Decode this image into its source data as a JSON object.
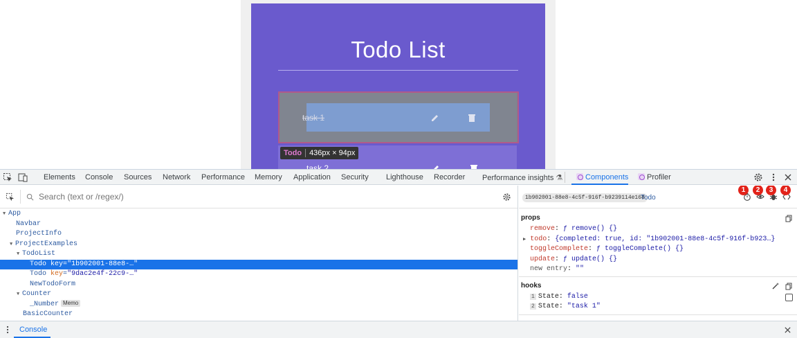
{
  "app": {
    "title": "Todo List",
    "todos": [
      {
        "text": "task 1",
        "completed": true
      },
      {
        "text": "task 2",
        "completed": false
      }
    ]
  },
  "inspect_tooltip": {
    "component": "Todo",
    "size": "436px × 94px"
  },
  "devtools": {
    "tabs": [
      "Elements",
      "Console",
      "Sources",
      "Network",
      "Performance",
      "Memory",
      "Application",
      "Security",
      "Lighthouse",
      "Recorder",
      "Performance insights"
    ],
    "react_tabs": [
      "Components",
      "Profiler"
    ],
    "active_tab": "Components",
    "search": {
      "placeholder": "Search (text or /regex/)"
    },
    "tree": [
      {
        "name": "App",
        "depth": 0,
        "expanded": true
      },
      {
        "name": "Navbar",
        "depth": 1
      },
      {
        "name": "ProjectInfo",
        "depth": 1
      },
      {
        "name": "ProjectExamples",
        "depth": 1,
        "expanded": true
      },
      {
        "name": "TodoList",
        "depth": 2,
        "expanded": true
      },
      {
        "name": "Todo",
        "depth": 3,
        "key": "\"1b902001-88e8-…\"",
        "selected": true
      },
      {
        "name": "Todo",
        "depth": 3,
        "key": "\"9dac2e4f-22c9-…\""
      },
      {
        "name": "NewTodoForm",
        "depth": 3
      },
      {
        "name": "Counter",
        "depth": 2,
        "expanded": true
      },
      {
        "name": "_Number",
        "depth": 3,
        "badge": "Memo"
      },
      {
        "name": "BasicCounter",
        "depth": 3
      }
    ],
    "selected": {
      "key": "1b902001-88e8-4c5f-916f-b9239114e168",
      "component": "Todo",
      "badges": [
        "1",
        "2",
        "3",
        "4"
      ],
      "props_title": "props",
      "props": [
        {
          "name": "remove",
          "value": "ƒ remove() {}"
        },
        {
          "name": "todo",
          "value": "{completed: true, id: \"1b902001-88e8-4c5f-916f-b923…}",
          "expandable": true
        },
        {
          "name": "toggleComplete",
          "value": "ƒ toggleComplete() {}"
        },
        {
          "name": "update",
          "value": "ƒ update() {}"
        }
      ],
      "new_entry": {
        "label": "new entry",
        "value": "\"\""
      },
      "hooks_title": "hooks",
      "hooks": [
        {
          "index": "1",
          "name": "State",
          "value": "false"
        },
        {
          "index": "2",
          "name": "State",
          "value": "\"task 1\""
        }
      ]
    },
    "drawer": {
      "tab": "Console"
    }
  }
}
